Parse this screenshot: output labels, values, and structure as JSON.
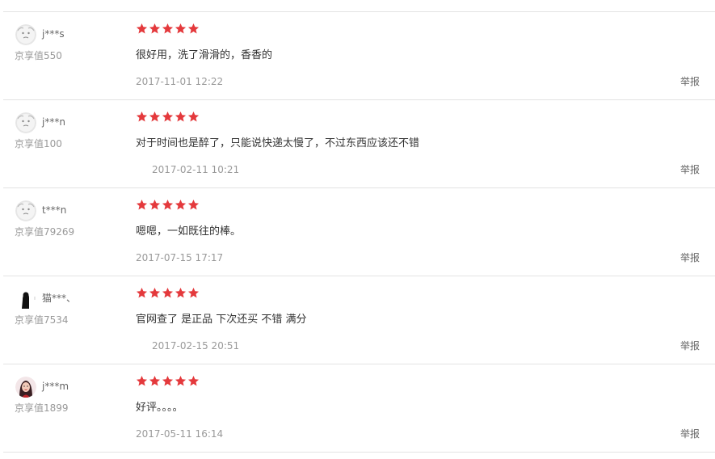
{
  "colors": {
    "star": "#e4393c",
    "border": "#e3e3e3",
    "muted": "#999999"
  },
  "reviews": [
    {
      "user": "j***s",
      "level": "京享值550",
      "rating": 5,
      "content": "很好用，洗了滑滑的，香香的",
      "date": "2017-11-01 12:22",
      "report": "举报",
      "avatar": "default-avatar-icon"
    },
    {
      "user": "j***n",
      "level": "京享值100",
      "rating": 5,
      "content": "对于时间也是醉了，只能说快递太慢了，不过东西应该还不错",
      "date": "2017-02-11 10:21",
      "report": "举报",
      "avatar": "default-avatar-icon"
    },
    {
      "user": "t***n",
      "level": "京享值79269",
      "rating": 5,
      "content": "嗯嗯，一如既往的棒。",
      "date": "2017-07-15 17:17",
      "report": "举报",
      "avatar": "default-avatar-icon"
    },
    {
      "user": "猫***、",
      "level": "京享值7534",
      "rating": 5,
      "content": "官网查了 是正品 下次还买 不错 满分",
      "date": "2017-02-15 20:51",
      "report": "举报",
      "avatar": "silhouette-avatar-icon"
    },
    {
      "user": "j***m",
      "level": "京享值1899",
      "rating": 5,
      "content": "好评。。。。",
      "date": "2017-05-11 16:14",
      "report": "举报",
      "avatar": "photo-avatar-icon"
    }
  ]
}
